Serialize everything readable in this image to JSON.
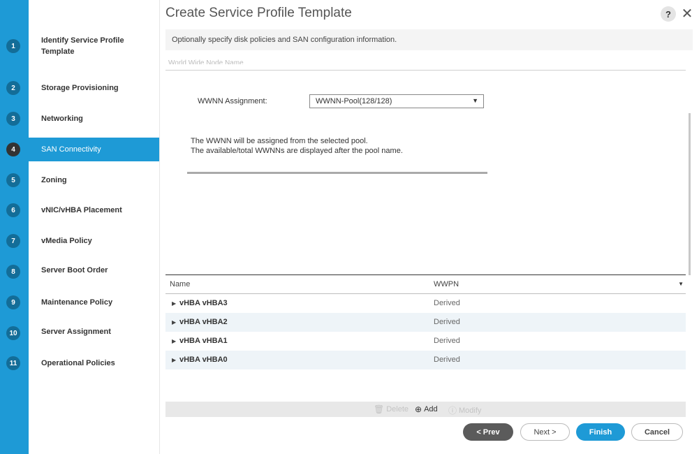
{
  "dialog": {
    "title": "Create Service Profile Template",
    "subtitle": "Optionally specify disk policies and SAN configuration information.",
    "help_label": "?",
    "close_label": "✕"
  },
  "steps": [
    {
      "num": "1",
      "label": "Identify Service Profile Template"
    },
    {
      "num": "2",
      "label": "Storage Provisioning"
    },
    {
      "num": "3",
      "label": "Networking"
    },
    {
      "num": "4",
      "label": "SAN Connectivity"
    },
    {
      "num": "5",
      "label": "Zoning"
    },
    {
      "num": "6",
      "label": "vNIC/vHBA Placement"
    },
    {
      "num": "7",
      "label": "vMedia Policy"
    },
    {
      "num": "8",
      "label": "Server Boot Order"
    },
    {
      "num": "9",
      "label": "Maintenance Policy"
    },
    {
      "num": "10",
      "label": "Server Assignment"
    },
    {
      "num": "11",
      "label": "Operational Policies"
    }
  ],
  "active_step": "4",
  "section": {
    "heading": "World Wide Node Name",
    "wwnn_label": "WWNN Assignment:",
    "wwnn_value": "WWNN-Pool(128/128)",
    "info_line1": "The WWNN will be assigned from the selected pool.",
    "info_line2": "The available/total WWNNs are displayed after the pool name."
  },
  "table": {
    "columns": [
      "Name",
      "WWPN"
    ],
    "rows": [
      {
        "name": "vHBA vHBA3",
        "wwpn": "Derived"
      },
      {
        "name": "vHBA vHBA2",
        "wwpn": "Derived"
      },
      {
        "name": "vHBA vHBA1",
        "wwpn": "Derived"
      },
      {
        "name": "vHBA vHBA0",
        "wwpn": "Derived"
      }
    ]
  },
  "actions": {
    "delete": "Delete",
    "add": "Add",
    "modify": "Modify"
  },
  "buttons": {
    "prev": "< Prev",
    "next": "Next >",
    "finish": "Finish",
    "cancel": "Cancel"
  },
  "colors": {
    "accent": "#1e9ad6",
    "step_num_bg": "#136d98",
    "prev_button": "#5b5b5b"
  }
}
